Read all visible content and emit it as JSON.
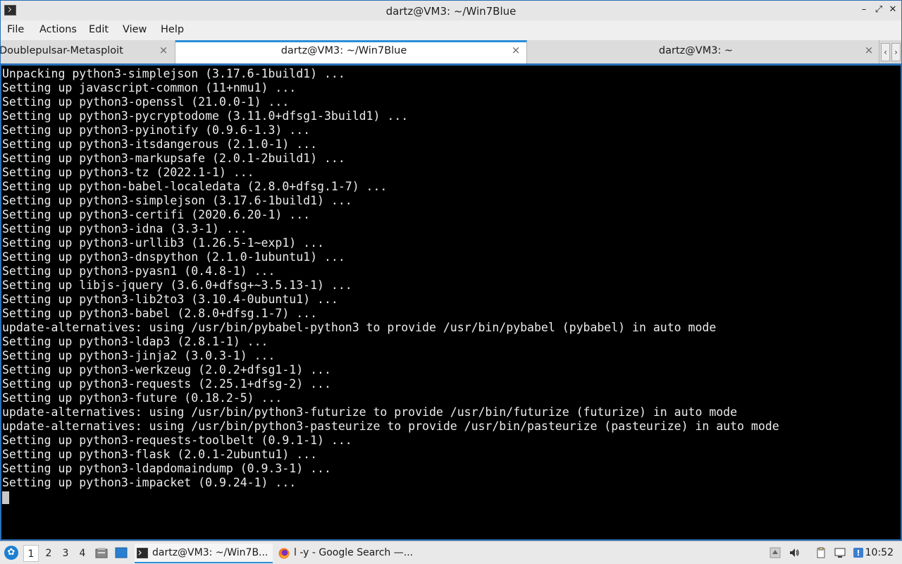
{
  "window": {
    "title": "dartz@VM3: ~/Win7Blue"
  },
  "menu": {
    "file": "File",
    "actions": "Actions",
    "edit": "Edit",
    "view": "View",
    "help": "Help"
  },
  "tabs": [
    {
      "label": "Doublepulsar-Metasploit",
      "active": false
    },
    {
      "label": "dartz@VM3: ~/Win7Blue",
      "active": true
    },
    {
      "label": "dartz@VM3: ~",
      "active": false
    }
  ],
  "terminal": {
    "lines": [
      "Unpacking python3-simplejson (3.17.6-1build1) ...",
      "Setting up javascript-common (11+nmu1) ...",
      "Setting up python3-openssl (21.0.0-1) ...",
      "Setting up python3-pycryptodome (3.11.0+dfsg1-3build1) ...",
      "Setting up python3-pyinotify (0.9.6-1.3) ...",
      "Setting up python3-itsdangerous (2.1.0-1) ...",
      "Setting up python3-markupsafe (2.0.1-2build1) ...",
      "Setting up python3-tz (2022.1-1) ...",
      "Setting up python-babel-localedata (2.8.0+dfsg.1-7) ...",
      "Setting up python3-simplejson (3.17.6-1build1) ...",
      "Setting up python3-certifi (2020.6.20-1) ...",
      "Setting up python3-idna (3.3-1) ...",
      "Setting up python3-urllib3 (1.26.5-1~exp1) ...",
      "Setting up python3-dnspython (2.1.0-1ubuntu1) ...",
      "Setting up python3-pyasn1 (0.4.8-1) ...",
      "Setting up libjs-jquery (3.6.0+dfsg+~3.5.13-1) ...",
      "Setting up python3-lib2to3 (3.10.4-0ubuntu1) ...",
      "Setting up python3-babel (2.8.0+dfsg.1-7) ...",
      "update-alternatives: using /usr/bin/pybabel-python3 to provide /usr/bin/pybabel (pybabel) in auto mode",
      "Setting up python3-ldap3 (2.8.1-1) ...",
      "Setting up python3-jinja2 (3.0.3-1) ...",
      "Setting up python3-werkzeug (2.0.2+dfsg1-1) ...",
      "Setting up python3-requests (2.25.1+dfsg-2) ...",
      "Setting up python3-future (0.18.2-5) ...",
      "update-alternatives: using /usr/bin/python3-futurize to provide /usr/bin/futurize (futurize) in auto mode",
      "update-alternatives: using /usr/bin/python3-pasteurize to provide /usr/bin/pasteurize (pasteurize) in auto mode",
      "Setting up python3-requests-toolbelt (0.9.1-1) ...",
      "Setting up python3-flask (2.0.1-2ubuntu1) ...",
      "Setting up python3-ldapdomaindump (0.9.3-1) ...",
      "Setting up python3-impacket (0.9.24-1) ..."
    ]
  },
  "taskbar": {
    "workspaces": [
      "1",
      "2",
      "3",
      "4"
    ],
    "active_workspace": "1",
    "tasks": [
      {
        "label": "dartz@VM3: ~/Win7B...",
        "icon": "terminal-icon",
        "active": true
      },
      {
        "label": "l -y - Google Search —...",
        "icon": "firefox-icon",
        "active": false
      }
    ],
    "clock": "10:52"
  },
  "colors": {
    "accent": "#2a8fd8",
    "window_border": "#2a6fb8",
    "terminal_bg": "#000000",
    "terminal_fg": "#ececec"
  }
}
